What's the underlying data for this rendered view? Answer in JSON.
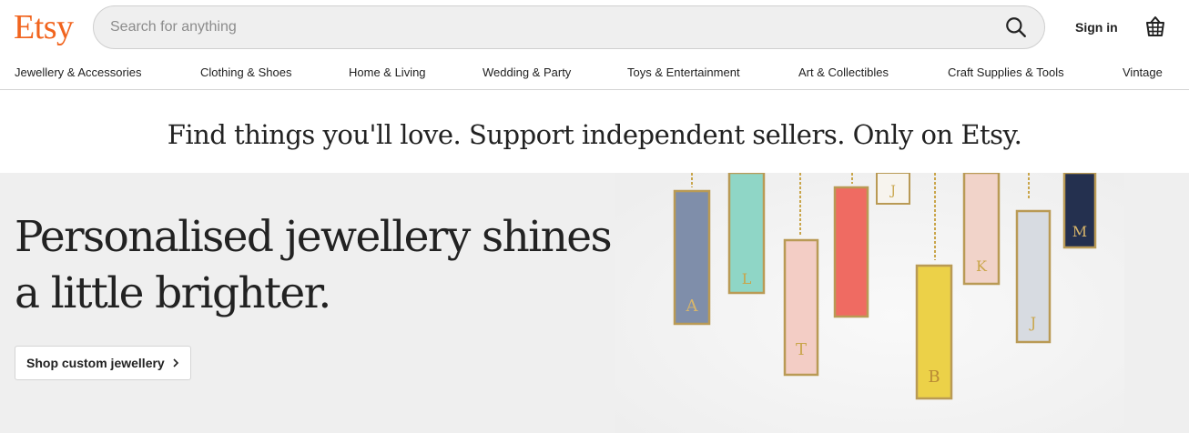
{
  "header": {
    "logo": "Etsy",
    "search_placeholder": "Search for anything",
    "search_value": "",
    "signin_label": "Sign in"
  },
  "categories": [
    "Jewellery & Accessories",
    "Clothing & Shoes",
    "Home & Living",
    "Wedding & Party",
    "Toys & Entertainment",
    "Art & Collectibles",
    "Craft Supplies & Tools",
    "Vintage"
  ],
  "tagline": "Find things you'll love. Support independent sellers. Only on Etsy.",
  "hero": {
    "title_line1": "Personalised jewellery shines",
    "title_line2": "a little brighter.",
    "button_label": "Shop custom jewellery"
  },
  "pendant_letters": [
    "A",
    "L",
    "T",
    "J",
    "B",
    "J",
    "K",
    "J",
    "M"
  ],
  "colors": {
    "brand": "#F1641E",
    "text": "#222222",
    "hero_bg": "#efefef"
  }
}
